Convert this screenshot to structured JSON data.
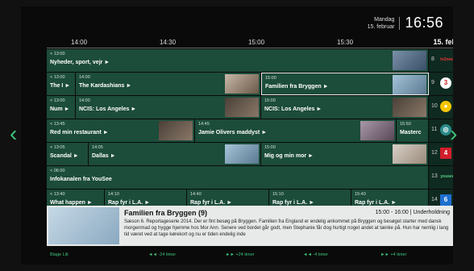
{
  "clock": {
    "day": "Mandag",
    "date": "15. februar",
    "time": "16:56"
  },
  "timebar": {
    "t1": "14:00",
    "t2": "14:30",
    "t3": "15:00",
    "t4": "15:30",
    "day": "15. feb"
  },
  "rows": [
    {
      "cells": [
        {
          "time": "< 13:00",
          "name": "Nyheder, sport, vejr ►"
        }
      ],
      "channel": {
        "num": "8",
        "logo": "tv2news"
      }
    },
    {
      "cells": [
        {
          "time": "< 13:00",
          "name": "The I ►"
        },
        {
          "time": "14:00",
          "name": "The Kardashians ►"
        },
        {
          "time": "15:00",
          "name": "Familien fra Bryggen ►"
        }
      ],
      "channel": {
        "num": "9",
        "logo": "3"
      }
    },
    {
      "cells": [
        {
          "time": "< 13:00",
          "name": "Num ►"
        },
        {
          "time": "14:00",
          "name": "NCIS: Los Angeles ►"
        },
        {
          "time": "15:00",
          "name": "NCIS: Los Angeles ►"
        }
      ],
      "channel": {
        "num": "10",
        "logo": "●"
      }
    },
    {
      "cells": [
        {
          "time": "< 13:45",
          "name": "Red min restaurant ►"
        },
        {
          "time": "14:45",
          "name": "Jamie Olivers maddyst ►"
        },
        {
          "time": "15:50",
          "name": "Masterc"
        }
      ],
      "channel": {
        "num": "11",
        "logo": "◎"
      }
    },
    {
      "cells": [
        {
          "time": "< 13:05",
          "name": "Scandal ►"
        },
        {
          "time": "14:05",
          "name": "Dallas ►"
        },
        {
          "time": "15:00",
          "name": "Mig og min mor ►"
        }
      ],
      "channel": {
        "num": "12",
        "logo": "4"
      }
    },
    {
      "cells": [
        {
          "time": "< 06:00",
          "name": "Infokanalen fra YouSee"
        }
      ],
      "channel": {
        "num": "13",
        "logo": "yousee"
      }
    },
    {
      "cells": [
        {
          "time": "< 13:40",
          "name": "What happen ►"
        },
        {
          "time": "14:10",
          "name": "Rap fyr i L.A. ►"
        },
        {
          "time": "14:40",
          "name": "Rap fyr i L.A. ►"
        },
        {
          "time": "15:10",
          "name": "Rap fyr i L.A. ►"
        },
        {
          "time": "15:40",
          "name": "Rap fyr i L.A. ►"
        }
      ],
      "channel": {
        "num": "14",
        "logo": "6"
      }
    }
  ],
  "info": {
    "title": "Familien fra Bryggen (9)",
    "meta": "15:00 - 16:00 | Underholdning",
    "desc": "Sæson 6. Reportageserie 2014. Der er fint besøg på Bryggen. Familien fra England er endelig ankommet på Bryggen og besøget starter med dansk morgenmad og hygge hjemme hos Mor Ann. Senere ved bordet går godt, men Stephanie får dog hurtigt noget andet at tænke på. Hun har nemlig i lang tid været ved at tage kørekort og nu er tiden endelig inde"
  },
  "footer": {
    "a": "Blage  Liit",
    "b": "◄◄ -24 timer",
    "c": "►► +24 timer",
    "d": "◄◄ -4 timer",
    "e": "►► +4 timer"
  },
  "colors": {
    "cell": "#1c4c3a",
    "accent": "#3ec47a"
  }
}
